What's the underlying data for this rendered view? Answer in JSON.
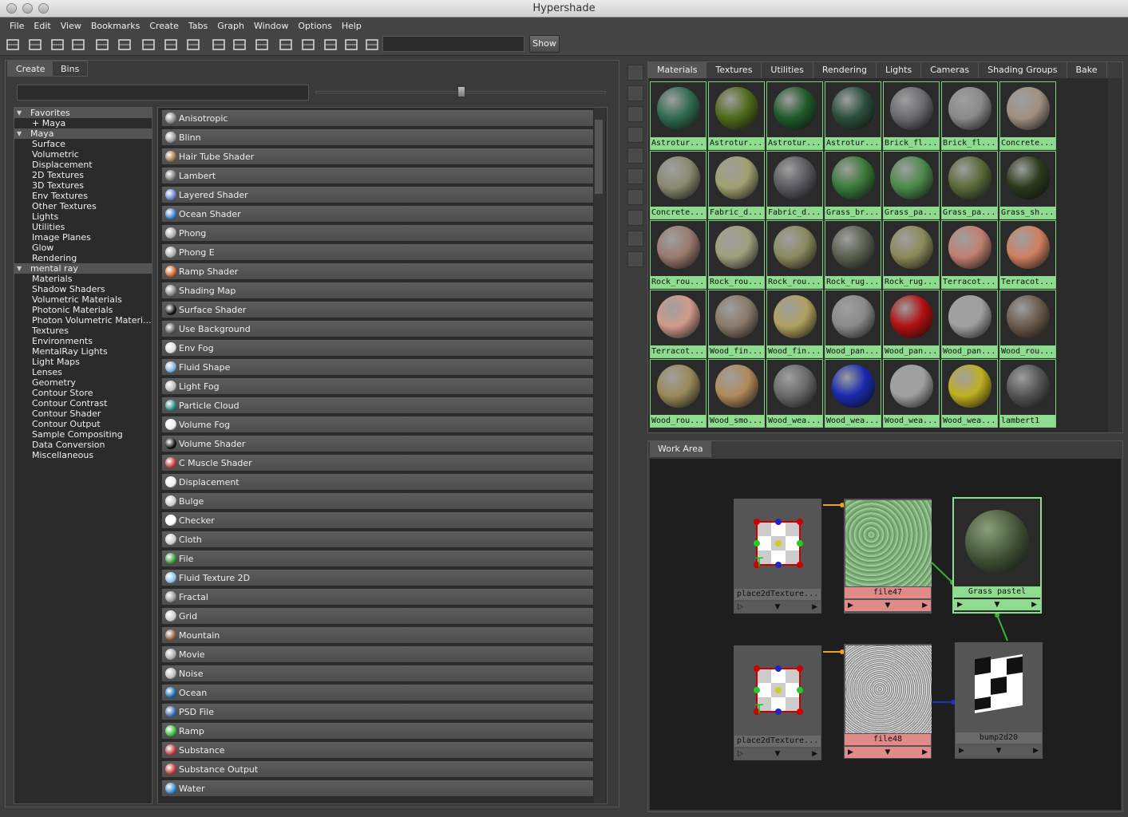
{
  "window": {
    "title": "Hypershade"
  },
  "menu": [
    "File",
    "Edit",
    "View",
    "Bookmarks",
    "Create",
    "Tabs",
    "Graph",
    "Window",
    "Options",
    "Help"
  ],
  "toolbar": {
    "show_label": "Show"
  },
  "left_tabs": [
    "Create",
    "Bins"
  ],
  "tree": [
    {
      "label": "Favorites",
      "type": "hdr"
    },
    {
      "label": "+ Maya",
      "type": "item"
    },
    {
      "label": "Maya",
      "type": "hdr"
    },
    {
      "label": "Surface",
      "type": "sub"
    },
    {
      "label": "Volumetric",
      "type": "sub"
    },
    {
      "label": "Displacement",
      "type": "sub"
    },
    {
      "label": "2D Textures",
      "type": "sub"
    },
    {
      "label": "3D Textures",
      "type": "sub"
    },
    {
      "label": "Env Textures",
      "type": "sub"
    },
    {
      "label": "Other Textures",
      "type": "sub"
    },
    {
      "label": "Lights",
      "type": "sub"
    },
    {
      "label": "Utilities",
      "type": "sub"
    },
    {
      "label": "Image Planes",
      "type": "sub"
    },
    {
      "label": "Glow",
      "type": "sub"
    },
    {
      "label": "Rendering",
      "type": "sub"
    },
    {
      "label": "mental ray",
      "type": "hdr"
    },
    {
      "label": "Materials",
      "type": "sub"
    },
    {
      "label": "Shadow Shaders",
      "type": "sub"
    },
    {
      "label": "Volumetric Materials",
      "type": "sub"
    },
    {
      "label": "Photonic Materials",
      "type": "sub"
    },
    {
      "label": "Photon Volumetric Materi...",
      "type": "sub"
    },
    {
      "label": "Textures",
      "type": "sub"
    },
    {
      "label": "Environments",
      "type": "sub"
    },
    {
      "label": "MentalRay Lights",
      "type": "sub"
    },
    {
      "label": "Light Maps",
      "type": "sub"
    },
    {
      "label": "Lenses",
      "type": "sub"
    },
    {
      "label": "Geometry",
      "type": "sub"
    },
    {
      "label": "Contour Store",
      "type": "sub"
    },
    {
      "label": "Contour Contrast",
      "type": "sub"
    },
    {
      "label": "Contour Shader",
      "type": "sub"
    },
    {
      "label": "Contour Output",
      "type": "sub"
    },
    {
      "label": "Sample Compositing",
      "type": "sub"
    },
    {
      "label": "Data Conversion",
      "type": "sub"
    },
    {
      "label": "Miscellaneous",
      "type": "sub"
    }
  ],
  "nodes_list": [
    {
      "label": "Anisotropic",
      "color": "#888"
    },
    {
      "label": "Blinn",
      "color": "#999"
    },
    {
      "label": "Hair Tube Shader",
      "color": "#a0724a"
    },
    {
      "label": "Lambert",
      "color": "#777"
    },
    {
      "label": "Layered Shader",
      "color": "#6a7fd0"
    },
    {
      "label": "Ocean Shader",
      "color": "#3a7fd0"
    },
    {
      "label": "Phong",
      "color": "#aaa"
    },
    {
      "label": "Phong E",
      "color": "#aaa"
    },
    {
      "label": "Ramp Shader",
      "color": "#d06a2a"
    },
    {
      "label": "Shading Map",
      "color": "#888"
    },
    {
      "label": "Surface Shader",
      "color": "#111"
    },
    {
      "label": "Use Background",
      "color": "#555"
    },
    {
      "label": "Env Fog",
      "color": "#ddd"
    },
    {
      "label": "Fluid Shape",
      "color": "#7fb0e0"
    },
    {
      "label": "Light Fog",
      "color": "#bbb"
    },
    {
      "label": "Particle Cloud",
      "color": "#2a8a8a"
    },
    {
      "label": "Volume Fog",
      "color": "#eee"
    },
    {
      "label": "Volume Shader",
      "color": "#111"
    },
    {
      "label": "C Muscle Shader",
      "color": "#c03a3a"
    },
    {
      "label": "Displacement",
      "color": "#eee"
    },
    {
      "label": "Bulge",
      "color": "#ccc"
    },
    {
      "label": "Checker",
      "color": "#fff"
    },
    {
      "label": "Cloth",
      "color": "#ccc"
    },
    {
      "label": "File",
      "color": "#3a9a3a"
    },
    {
      "label": "Fluid Texture 2D",
      "color": "#8fc0e8"
    },
    {
      "label": "Fractal",
      "color": "#999"
    },
    {
      "label": "Grid",
      "color": "#ccc"
    },
    {
      "label": "Mountain",
      "color": "#8a5a3a"
    },
    {
      "label": "Movie",
      "color": "#aaa"
    },
    {
      "label": "Noise",
      "color": "#bbb"
    },
    {
      "label": "Ocean",
      "color": "#1a6ab0"
    },
    {
      "label": "PSD File",
      "color": "#3a6ab0"
    },
    {
      "label": "Ramp",
      "color": "#3ac03a"
    },
    {
      "label": "Substance",
      "color": "#c03a3a"
    },
    {
      "label": "Substance Output",
      "color": "#c03a3a"
    },
    {
      "label": "Water",
      "color": "#3a8ad0"
    }
  ],
  "mat_tabs": [
    "Materials",
    "Textures",
    "Utilities",
    "Rendering",
    "Lights",
    "Cameras",
    "Shading Groups",
    "Bake"
  ],
  "swatches": [
    {
      "label": "Astrotur...",
      "color": "#2f6b4f"
    },
    {
      "label": "Astrotur...",
      "color": "#4f6a1a"
    },
    {
      "label": "Astrotur...",
      "color": "#1f5a2a"
    },
    {
      "label": "Astrotur...",
      "color": "#2a4f3a"
    },
    {
      "label": "Brick_fl...",
      "color": "#6a6a70"
    },
    {
      "label": "Brick_fl...",
      "color": "#8a8a8a"
    },
    {
      "label": "Concrete...",
      "color": "#a09080"
    },
    {
      "label": "Concrete...",
      "color": "#8a8a70"
    },
    {
      "label": "Fabric_d...",
      "color": "#a0a070"
    },
    {
      "label": "Fabric_d...",
      "color": "#5a5a60"
    },
    {
      "label": "Grass_br...",
      "color": "#3a7a3a"
    },
    {
      "label": "Grass_pa...",
      "color": "#4a8a4a"
    },
    {
      "label": "Grass_pa...",
      "color": "#5a6a3a"
    },
    {
      "label": "Grass_sh...",
      "color": "#2a3a1a"
    },
    {
      "label": "Rock_rou...",
      "color": "#9a7a70"
    },
    {
      "label": "Rock_rou...",
      "color": "#a0a080"
    },
    {
      "label": "Rock_rou...",
      "color": "#8a8a60"
    },
    {
      "label": "Rock_rug...",
      "color": "#5a6050"
    },
    {
      "label": "Rock_rug...",
      "color": "#8a8a5a"
    },
    {
      "label": "Terracot...",
      "color": "#c08070"
    },
    {
      "label": "Terracot...",
      "color": "#d08060"
    },
    {
      "label": "Terracot...",
      "color": "#d09a8a"
    },
    {
      "label": "Wood_fin...",
      "color": "#8a7a6a"
    },
    {
      "label": "Wood_fin...",
      "color": "#b0a060"
    },
    {
      "label": "Wood_pan...",
      "color": "#8a8a8a"
    },
    {
      "label": "Wood_pan...",
      "color": "#b01010"
    },
    {
      "label": "Wood_pan...",
      "color": "#a0a0a0"
    },
    {
      "label": "Wood_rou...",
      "color": "#6a5a4a"
    },
    {
      "label": "Wood_rou...",
      "color": "#9a8a5a"
    },
    {
      "label": "Wood_smo...",
      "color": "#b08a5a"
    },
    {
      "label": "Wood_wea...",
      "color": "#6a6a6a"
    },
    {
      "label": "Wood_wea...",
      "color": "#1a2ab0"
    },
    {
      "label": "Wood_wea...",
      "color": "#a0a0a0"
    },
    {
      "label": "Wood_wea...",
      "color": "#c0b020"
    },
    {
      "label": "lambert1",
      "color": "#555"
    }
  ],
  "work_area": {
    "tab_label": "Work Area",
    "nodes": [
      {
        "id": "place1",
        "label": "place2dTexture...",
        "kind": "place"
      },
      {
        "id": "file47",
        "label": "file47",
        "kind": "file_green"
      },
      {
        "id": "grass",
        "label": "Grass pastel",
        "kind": "shader"
      },
      {
        "id": "place2",
        "label": "place2dTexture...",
        "kind": "place"
      },
      {
        "id": "file48",
        "label": "file48",
        "kind": "file_noise"
      },
      {
        "id": "bump",
        "label": "bump2d20",
        "kind": "bump"
      }
    ]
  }
}
